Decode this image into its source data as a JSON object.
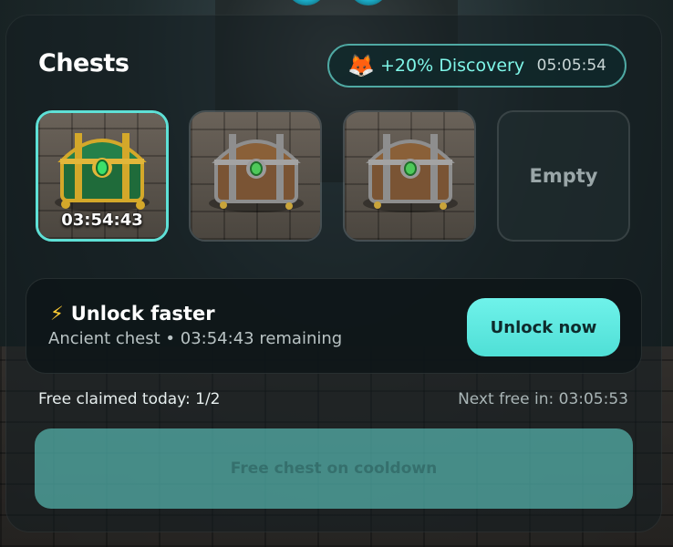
{
  "header": {
    "title": "Chests",
    "boost": {
      "icon": "fox-icon",
      "glyph": "🦊",
      "label": "+20% Discovery",
      "timer": "05:05:54"
    }
  },
  "slots": [
    {
      "type": "ancient",
      "state": "unlocking",
      "timer": "03:54:43"
    },
    {
      "type": "iron",
      "state": "locked"
    },
    {
      "type": "iron",
      "state": "locked"
    },
    {
      "type": "empty",
      "label": "Empty"
    }
  ],
  "unlock": {
    "icon": "lightning-icon",
    "glyph": "⚡",
    "title": "Unlock faster",
    "subtitle": "Ancient chest • 03:54:43 remaining",
    "button": "Unlock now"
  },
  "free": {
    "claimed": "Free claimed today: 1/2",
    "next": "Next free in: 03:05:53",
    "button": "Free chest on cooldown"
  },
  "colors": {
    "accent": "#5ee0d6",
    "boost_text": "#7ff6e8",
    "bolt": "#ffcc33"
  }
}
